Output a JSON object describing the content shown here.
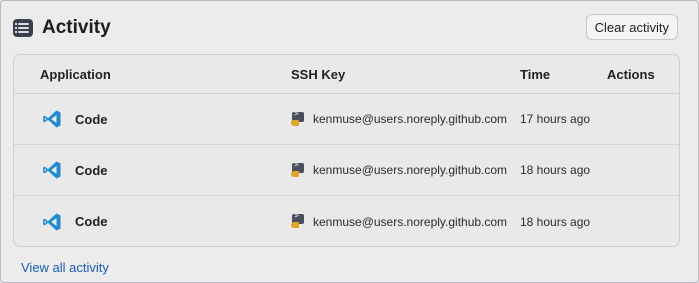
{
  "header": {
    "title": "Activity",
    "clear_button": "Clear activity",
    "icon": "activity-list-icon"
  },
  "table": {
    "columns": {
      "application": "Application",
      "ssh_key": "SSH Key",
      "time": "Time",
      "actions": "Actions"
    },
    "rows": [
      {
        "app": "Code",
        "app_icon": "vscode-icon",
        "key": "kenmuse@users.noreply.github.com",
        "key_icon": "ssh-key-icon",
        "time": "17 hours ago"
      },
      {
        "app": "Code",
        "app_icon": "vscode-icon",
        "key": "kenmuse@users.noreply.github.com",
        "key_icon": "ssh-key-icon",
        "time": "18 hours ago"
      },
      {
        "app": "Code",
        "app_icon": "vscode-icon",
        "key": "kenmuse@users.noreply.github.com",
        "key_icon": "ssh-key-icon",
        "time": "18 hours ago"
      }
    ]
  },
  "footer": {
    "view_all": "View all activity"
  },
  "colors": {
    "link": "#1a5fb4",
    "vscode_blue": "#1f8ad2",
    "key_gold": "#e0a524"
  }
}
